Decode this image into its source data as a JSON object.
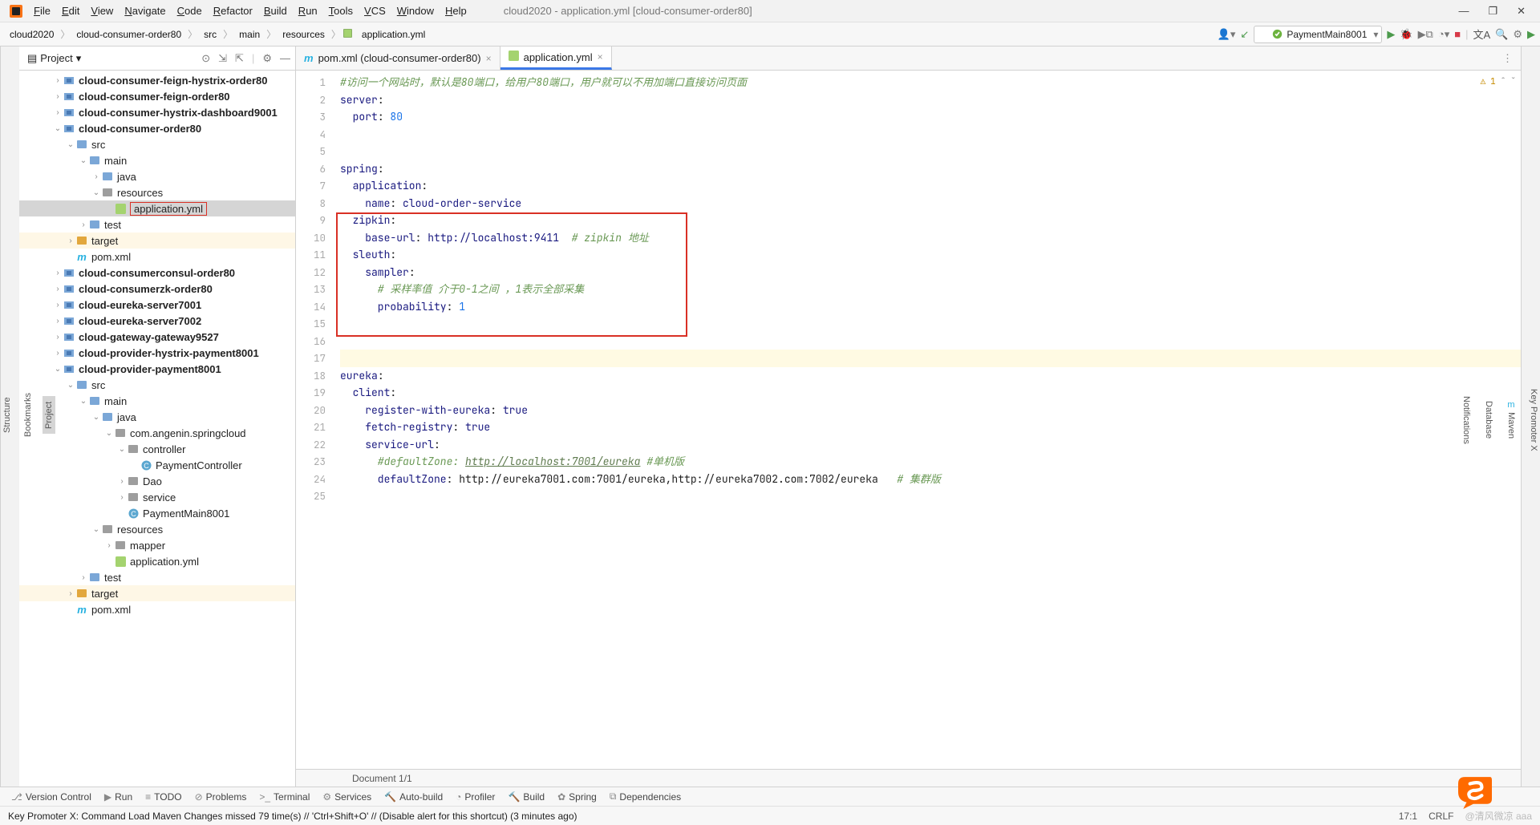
{
  "window": {
    "title": "cloud2020 - application.yml [cloud-consumer-order80]"
  },
  "menu": [
    "File",
    "Edit",
    "View",
    "Navigate",
    "Code",
    "Refactor",
    "Build",
    "Run",
    "Tools",
    "VCS",
    "Window",
    "Help"
  ],
  "breadcrumb": [
    "cloud2020",
    "cloud-consumer-order80",
    "src",
    "main",
    "resources",
    "application.yml"
  ],
  "run_config": "PaymentMain8001",
  "project_header": "Project",
  "tree": [
    {
      "d": 2,
      "a": ">",
      "i": "mod",
      "t": "cloud-consumer-feign-hystrix-order80",
      "b": true
    },
    {
      "d": 2,
      "a": ">",
      "i": "mod",
      "t": "cloud-consumer-feign-order80",
      "b": true
    },
    {
      "d": 2,
      "a": ">",
      "i": "mod",
      "t": "cloud-consumer-hystrix-dashboard9001",
      "b": true
    },
    {
      "d": 2,
      "a": "v",
      "i": "mod",
      "t": "cloud-consumer-order80",
      "b": true
    },
    {
      "d": 3,
      "a": "v",
      "i": "fb",
      "t": "src"
    },
    {
      "d": 4,
      "a": "v",
      "i": "fb",
      "t": "main"
    },
    {
      "d": 5,
      "a": ">",
      "i": "fb",
      "t": "java"
    },
    {
      "d": 5,
      "a": "v",
      "i": "fg",
      "t": "resources"
    },
    {
      "d": 6,
      "a": "",
      "i": "yml",
      "t": "application.yml",
      "sel": true
    },
    {
      "d": 4,
      "a": ">",
      "i": "fb",
      "t": "test"
    },
    {
      "d": 3,
      "a": ">",
      "i": "fo",
      "t": "target",
      "hl": true
    },
    {
      "d": 3,
      "a": "",
      "i": "pom",
      "t": "pom.xml"
    },
    {
      "d": 2,
      "a": ">",
      "i": "mod",
      "t": "cloud-consumerconsul-order80",
      "b": true
    },
    {
      "d": 2,
      "a": ">",
      "i": "mod",
      "t": "cloud-consumerzk-order80",
      "b": true
    },
    {
      "d": 2,
      "a": ">",
      "i": "mod",
      "t": "cloud-eureka-server7001",
      "b": true
    },
    {
      "d": 2,
      "a": ">",
      "i": "mod",
      "t": "cloud-eureka-server7002",
      "b": true
    },
    {
      "d": 2,
      "a": ">",
      "i": "mod",
      "t": "cloud-gateway-gateway9527",
      "b": true
    },
    {
      "d": 2,
      "a": ">",
      "i": "mod",
      "t": "cloud-provider-hystrix-payment8001",
      "b": true
    },
    {
      "d": 2,
      "a": "v",
      "i": "mod",
      "t": "cloud-provider-payment8001",
      "b": true
    },
    {
      "d": 3,
      "a": "v",
      "i": "fb",
      "t": "src"
    },
    {
      "d": 4,
      "a": "v",
      "i": "fb",
      "t": "main"
    },
    {
      "d": 5,
      "a": "v",
      "i": "fb",
      "t": "java"
    },
    {
      "d": 6,
      "a": "v",
      "i": "fg",
      "t": "com.angenin.springcloud"
    },
    {
      "d": 7,
      "a": "v",
      "i": "fg",
      "t": "controller"
    },
    {
      "d": 8,
      "a": "",
      "i": "cls",
      "t": "PaymentController"
    },
    {
      "d": 7,
      "a": ">",
      "i": "fg",
      "t": "Dao"
    },
    {
      "d": 7,
      "a": ">",
      "i": "fg",
      "t": "service"
    },
    {
      "d": 7,
      "a": "",
      "i": "cls",
      "t": "PaymentMain8001"
    },
    {
      "d": 5,
      "a": "v",
      "i": "fg",
      "t": "resources"
    },
    {
      "d": 6,
      "a": ">",
      "i": "fg",
      "t": "mapper"
    },
    {
      "d": 6,
      "a": "",
      "i": "yml",
      "t": "application.yml"
    },
    {
      "d": 4,
      "a": ">",
      "i": "fb",
      "t": "test"
    },
    {
      "d": 3,
      "a": ">",
      "i": "fo",
      "t": "target",
      "hl": true
    },
    {
      "d": 3,
      "a": "",
      "i": "pom",
      "t": "pom.xml"
    }
  ],
  "tabs": [
    {
      "label": "pom.xml (cloud-consumer-order80)",
      "icon": "pom",
      "active": false
    },
    {
      "label": "application.yml",
      "icon": "yml",
      "active": true
    }
  ],
  "gutter_lines": 25,
  "code": {
    "l1": "#访问一个网站时，默认是80端口，给用户80端口，用户就可以不用加端口直接访问页面",
    "l2a": "server",
    "l2b": ":",
    "l3a": "  port",
    "l3b": ": ",
    "l3c": "80",
    "l6a": "spring",
    "l6b": ":",
    "l7a": "  application",
    "l7b": ":",
    "l8a": "    name",
    "l8b": ": ",
    "l8c": "cloud-order-service",
    "l9a": "  zipkin",
    "l9b": ":",
    "l10a": "    base-url",
    "l10b": ": ",
    "l10c": "http://localhost:9411  ",
    "l10d": "# zipkin 地址",
    "l11a": "  sleuth",
    "l11b": ":",
    "l12a": "    sampler",
    "l12b": ":",
    "l13": "      # 采样率值 介于0-1之间 ，1表示全部采集",
    "l14a": "      probability",
    "l14b": ": ",
    "l14c": "1",
    "l18a": "eureka",
    "l18b": ":",
    "l19a": "  client",
    "l19b": ":",
    "l20a": "    register-with-eureka",
    "l20b": ": ",
    "l20c": "true",
    "l21a": "    fetch-registry",
    "l21b": ": ",
    "l21c": "true",
    "l22a": "    service-url",
    "l22b": ":",
    "l23a": "      #defaultZone: ",
    "l23b": "http://localhost:7001/eureka",
    "l23c": " #单机版",
    "l24a": "      defaultZone",
    "l24b": ": ",
    "l24c": "http://eureka7001.com:7001/eureka,http://eureka7002.com:7002/eureka   ",
    "l24d": "# 集群版"
  },
  "inspections": {
    "warn": "1"
  },
  "editor_footer": "Document 1/1",
  "bottom_tools": [
    "Version Control",
    "Run",
    "TODO",
    "Problems",
    "Terminal",
    "Services",
    "Auto-build",
    "Profiler",
    "Build",
    "Spring",
    "Dependencies"
  ],
  "status": {
    "msg": "Key Promoter X: Command Load Maven Changes missed 79 time(s) // 'Ctrl+Shift+O' // (Disable alert for this shortcut) (3 minutes ago)",
    "pos": "17:1",
    "enc": "CRLF",
    "ime": "@清风微凉 aaa"
  },
  "right_tools": [
    "Key Promoter X",
    "Maven",
    "Database",
    "Notifications"
  ],
  "left_tools": [
    "Project",
    "Bookmarks",
    "Structure"
  ]
}
